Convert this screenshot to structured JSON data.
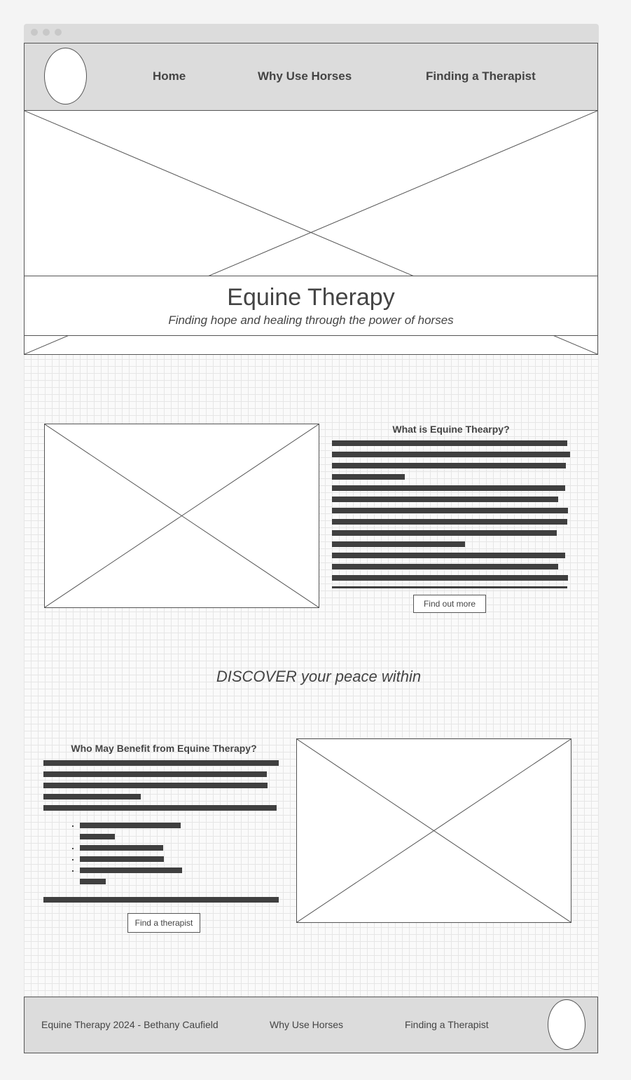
{
  "browser": {
    "traffic_lights": [
      "close-dot",
      "minimize-dot",
      "maximize-dot"
    ]
  },
  "header": {
    "logo_icon": "logo-placeholder-ellipse",
    "nav": [
      {
        "label": "Home"
      },
      {
        "label": "Why Use Horses"
      },
      {
        "label": "Finding a Therapist"
      }
    ]
  },
  "hero": {
    "image_icon": "image-placeholder",
    "title": "Equine Therapy",
    "subtitle": "Finding hope and healing through the power of horses"
  },
  "section_what": {
    "image_icon": "image-placeholder",
    "heading": "What is Equine Thearpy?",
    "button_label": "Find out more"
  },
  "tagline": "DISCOVER your peace within",
  "section_benefit": {
    "heading": "Who May Benefit from Equine Therapy?",
    "button_label": "Find a therapist",
    "image_icon": "image-placeholder"
  },
  "footer": {
    "copyright": "Equine Therapy 2024 - Bethany Caufield",
    "links": [
      {
        "label": "Why Use Horses"
      },
      {
        "label": "Finding a Therapist"
      }
    ],
    "logo_icon": "logo-placeholder-ellipse"
  },
  "colors": {
    "page_background": "#f4f4f4",
    "chrome": "#dcdcdc",
    "text": "#444444",
    "placeholder_bars": "#3f3f3f",
    "grid": "#e4e4e4"
  }
}
